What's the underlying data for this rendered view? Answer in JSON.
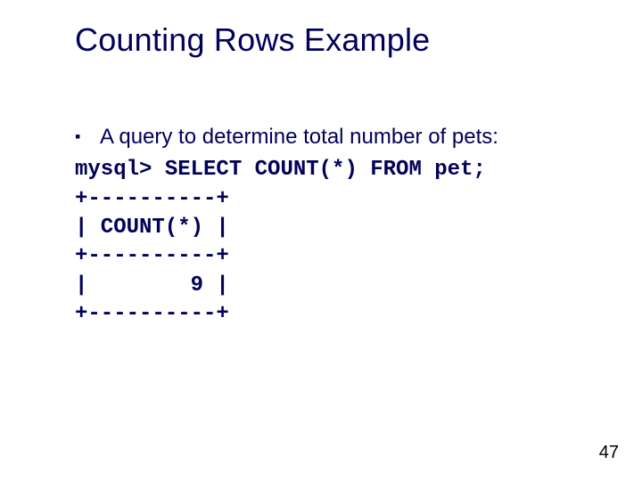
{
  "slide": {
    "title": "Counting Rows Example",
    "bullet_text": "A query to determine total number of pets:",
    "code": "mysql> SELECT COUNT(*) FROM pet;\n+----------+\n| COUNT(*) |\n+----------+\n|        9 |\n+----------+",
    "page_number": "47"
  }
}
